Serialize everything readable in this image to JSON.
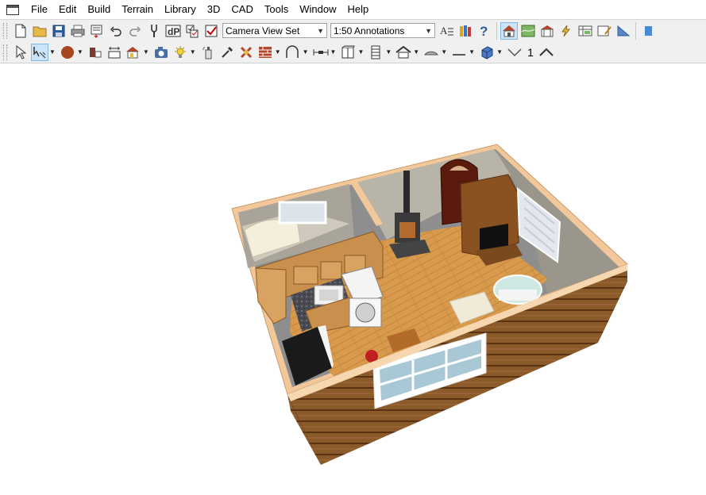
{
  "menubar": {
    "items": [
      "File",
      "Edit",
      "Build",
      "Terrain",
      "Library",
      "3D",
      "CAD",
      "Tools",
      "Window",
      "Help"
    ]
  },
  "toolbar1": {
    "view_set": {
      "selected": "Camera View Set"
    },
    "annotation_set": {
      "selected": "1:50 Annotations"
    }
  },
  "toolbar2": {
    "text_number": "1"
  },
  "view": {
    "type": "3D camera view of a small cabin interior",
    "wall_color": "#8b5a2b",
    "floor_color": "#d89a4c"
  }
}
